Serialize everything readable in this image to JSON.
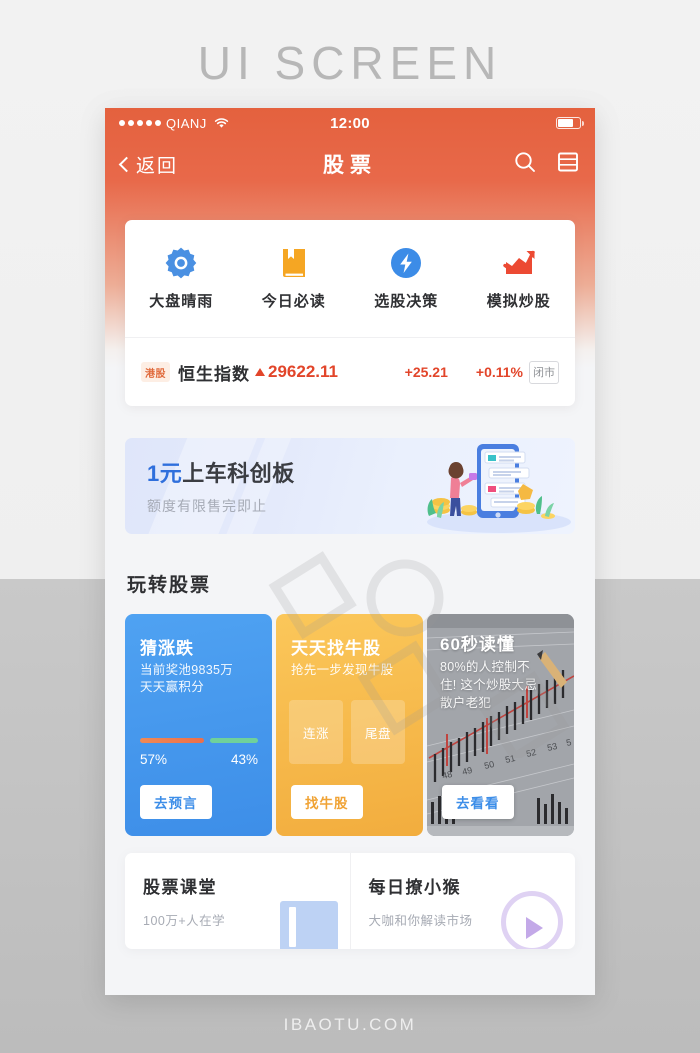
{
  "outer": {
    "title": "UI SCREEN",
    "footer": "IBAOTU.COM"
  },
  "status_bar": {
    "carrier": "QIANJ",
    "time": "12:00",
    "signal_dots": 5,
    "wifi_icon": "wifi-icon",
    "battery_icon": "battery-icon",
    "battery_level": 75
  },
  "navbar": {
    "back_label": "返回",
    "title": "股票",
    "search_icon": "search-icon",
    "menu_icon": "list-menu-icon"
  },
  "quick_entries": [
    {
      "label": "大盘晴雨",
      "icon": "sun-burst-icon",
      "color": "#4a90e2"
    },
    {
      "label": "今日必读",
      "icon": "book-icon",
      "color": "#f5a623"
    },
    {
      "label": "选股决策",
      "icon": "lightning-bolt-icon",
      "color": "#3c8ce7"
    },
    {
      "label": "模拟炒股",
      "icon": "trend-up-chart-icon",
      "color": "#ec4a33"
    }
  ],
  "ticker": {
    "market_tag": "港股",
    "index_name": "恒生指数",
    "direction_icon": "triangle-up-icon",
    "value": "29622.11",
    "change": "+25.21",
    "percent": "+0.11%",
    "market_status": "闭市",
    "up_color": "#e2452a"
  },
  "banner": {
    "title_prefix": "1元",
    "title_rest": "上车科创板",
    "subtitle": "额度有限售完即止",
    "illustration": "woman-with-phone-and-coins-illustration",
    "accent_color": "#2f6fdc"
  },
  "section": {
    "title": "玩转股票"
  },
  "feature_cards": [
    {
      "id": "guess-up-down",
      "title": "猜涨跌",
      "desc": "当前奖池9835万\n天天赢积分",
      "desc_line1": "当前奖池9835万",
      "desc_line2": "天天赢积分",
      "bar_left_pct": "57%",
      "bar_right_pct": "43%",
      "bar_left_value": 57,
      "bar_right_value": 43,
      "bar_left_color": "#ec6f4a",
      "bar_right_color": "#6fd19a",
      "button": "去预言",
      "bg_color": "#4397ee"
    },
    {
      "id": "find-bull-stock",
      "title": "天天找牛股",
      "desc_line1": "抢先一步发现牛股",
      "chips": [
        "连涨",
        "尾盘"
      ],
      "button": "找牛股",
      "bg_color": "#f5b94b"
    },
    {
      "id": "sixty-second-read",
      "title": "60秒读懂",
      "desc_line1": "80%的人控制不",
      "desc_line2": "住! 这个炒股大忌",
      "desc_line3": "散户老犯",
      "button": "去看看",
      "bg_color": "#9b9ea3",
      "background_image": "candlestick-chart-photo"
    }
  ],
  "bottom_cards": [
    {
      "id": "stock-classroom",
      "title": "股票课堂",
      "subtitle": "100万+人在学",
      "art": "book-illustration"
    },
    {
      "id": "daily-monkey",
      "title": "每日撩小猴",
      "subtitle": "大咖和你解读市场",
      "art": "play-button-illustration"
    }
  ],
  "watermark": {
    "text": "包图网"
  }
}
